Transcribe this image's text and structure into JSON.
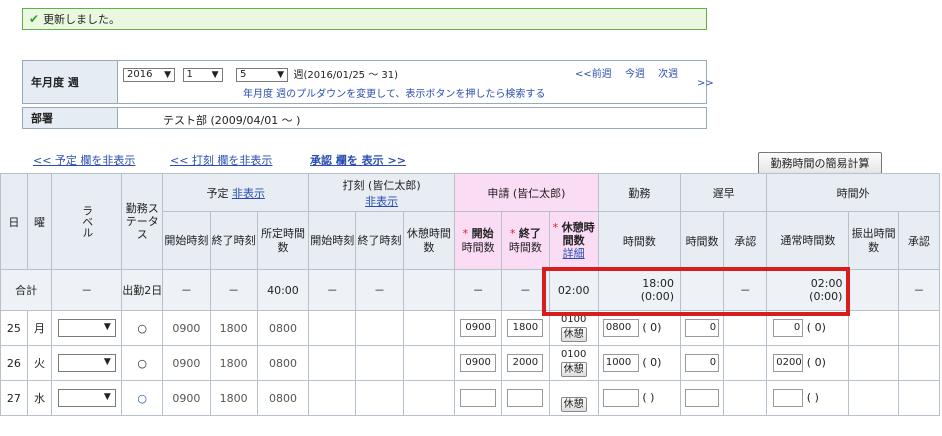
{
  "success": {
    "icon": "check-icon",
    "message": "更新しました。"
  },
  "period": {
    "label": "年月度 週",
    "year": "2016",
    "month": "1",
    "week": "5",
    "week_range": "週(2016/01/25 ～ 31)",
    "hint": "年月度 週のプルダウンを変更して、表示ボタンを押したら検索する",
    "prev": "<<前週",
    "current": "今週",
    "next": "次週",
    "next2": ">>"
  },
  "department": {
    "label": "部署",
    "value": "テスト部 (2009/04/01 ～ )"
  },
  "toggles": {
    "schedule": "<< 予定 欄を非表示",
    "punch": "<< 打刻 欄を非表示",
    "approval": "承認 欄を 表示 >>"
  },
  "calc_button": "勤務時間の簡易計算",
  "headers": {
    "day": "日",
    "weekday": "曜",
    "label": "ラベル",
    "status": "勤務ステータス",
    "schedule": "予定",
    "hide": "非表示",
    "punch": "打刻 (皆仁太郎)",
    "application": "申請 (皆仁太郎)",
    "work": "勤務",
    "late": "遅早",
    "overtime": "時間外",
    "start": "開始時刻",
    "end": "終了時刻",
    "planned": "所定時間数",
    "break": "休憩時間数",
    "req_start": "開始",
    "req_end": "終了",
    "req_break": "休憩時間数",
    "detail": "詳細",
    "asterisk": "*",
    "hours": "時間数",
    "approve": "承認",
    "normal": "通常時間数",
    "transfer": "振出時間数"
  },
  "total": {
    "label": "合計",
    "dash": "－",
    "status": "出勤2日",
    "planned": "40:00",
    "req_break": "02:00",
    "work": "18:00",
    "work_sub": "(0:00)",
    "ot": "02:00",
    "ot_sub": "(0:00)"
  },
  "rows": [
    {
      "day": "25",
      "wd": "月",
      "circle": "○",
      "start": "0900",
      "end": "1800",
      "planned": "0800",
      "req_start": "0900",
      "req_end": "1800",
      "req_break": "0100",
      "break_btn": "休憩",
      "work": "0800",
      "work_paren": "(  0)",
      "late": "0",
      "ot": "0",
      "ot_paren": "(  0)"
    },
    {
      "day": "26",
      "wd": "火",
      "circle": "○",
      "start": "0900",
      "end": "1800",
      "planned": "0800",
      "req_start": "0900",
      "req_end": "2000",
      "req_break": "0100",
      "break_btn": "休憩",
      "work": "1000",
      "work_paren": "(  0)",
      "late": "0",
      "ot": "0200",
      "ot_paren": "(  0)"
    },
    {
      "day": "27",
      "wd": "水",
      "circle": "○",
      "start": "0900",
      "end": "1800",
      "planned": "0800",
      "req_start": "",
      "req_end": "",
      "req_break": "",
      "break_btn": "休憩",
      "work": "",
      "work_paren": "(   )",
      "late": "",
      "ot": "",
      "ot_paren": "(   )"
    }
  ],
  "colors": {
    "success_bg": "#eaf8e0",
    "pink": "#fbdcf5",
    "highlight": "#d61e1e",
    "link": "#2b4fb0"
  }
}
